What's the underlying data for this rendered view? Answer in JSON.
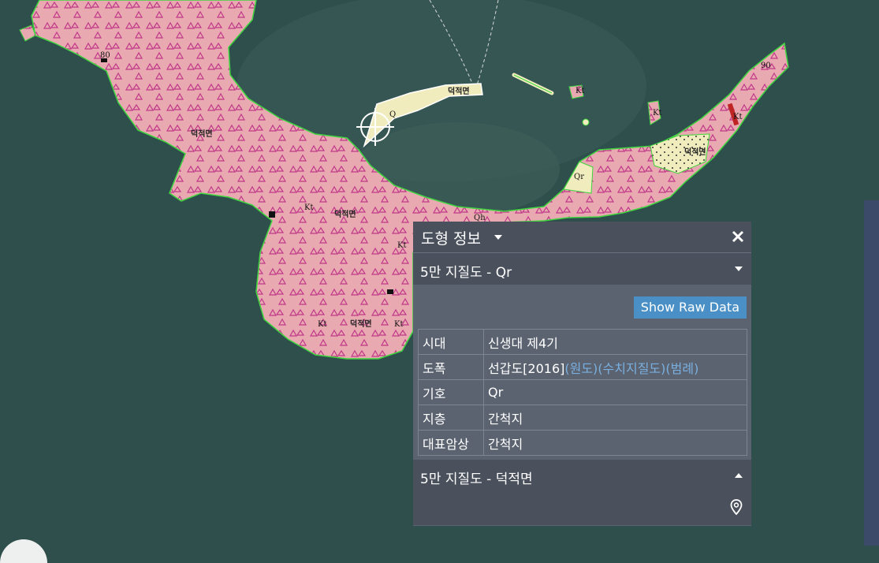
{
  "map": {
    "place_labels": [
      "덕적면",
      "덕적면",
      "덕적면",
      "덕적면",
      "덕적면"
    ],
    "unit_symbols": [
      "Q",
      "Kt",
      "Kt",
      "Kt",
      "Kt",
      "Qr",
      "Qh",
      "Kt",
      "Kt",
      "Kt",
      "80",
      "90"
    ],
    "colors": {
      "sea": "#2e4f4c",
      "formation_fill": "#e9a9b1",
      "triangle_symbol": "#c0398a",
      "boundary": "#3fd63f",
      "tidal_flat": "#f1ecbe"
    }
  },
  "panel": {
    "title": "도형 정보",
    "close_icon": "close-icon",
    "section1_label": "5만 지질도 - Qr",
    "raw_button": "Show Raw Data",
    "rows": [
      {
        "key": "시대",
        "value": "신생대 제4기"
      },
      {
        "key": "도폭",
        "value": "선갑도[2016]",
        "links": [
          "(원도)",
          "(수치지질도)",
          "(범례)"
        ]
      },
      {
        "key": "기호",
        "value": "Qr"
      },
      {
        "key": "지층",
        "value": "간척지"
      },
      {
        "key": "대표암상",
        "value": "간척지"
      }
    ],
    "section2_label": "5만 지질도 - 덕적면",
    "pin_icon": "location-pin-icon"
  }
}
